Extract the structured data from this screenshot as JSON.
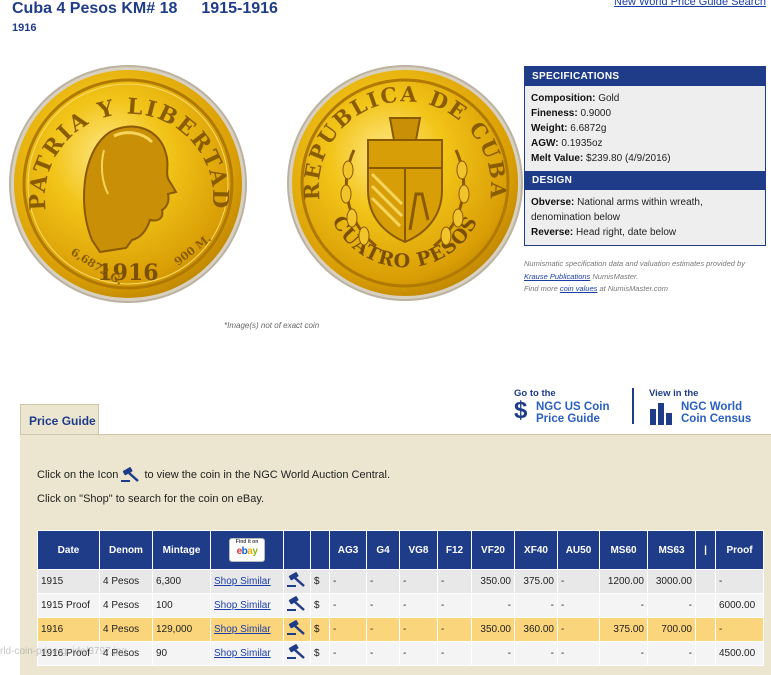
{
  "header": {
    "title": "Cuba 4 Pesos KM# 18",
    "years": "1915-1916",
    "subyear": "1916",
    "top_link": "New World Price Guide Search"
  },
  "coin_obverse": {
    "legend": "PATRIA Y LIBERTAD",
    "date": "1916",
    "fineness": "900 M.",
    "weight": "6,6872 G."
  },
  "coin_reverse": {
    "legend": "REPUBLICA DE CUBA",
    "denomination": "CUATRO PESOS"
  },
  "image_note": "*Image(s) not of exact coin",
  "specifications": {
    "heading": "SPECIFICATIONS",
    "items": [
      {
        "label": "Composition:",
        "value": "Gold"
      },
      {
        "label": "Fineness:",
        "value": "0.9000"
      },
      {
        "label": "Weight:",
        "value": "6.6872g"
      },
      {
        "label": "AGW:",
        "value": "0.1935oz"
      },
      {
        "label": "Melt Value:",
        "value": "$239.80 (4/9/2016)"
      }
    ]
  },
  "design": {
    "heading": "DESIGN",
    "obverse_label": "Obverse:",
    "obverse_value": "National arms within wreath, denomination below",
    "reverse_label": "Reverse:",
    "reverse_value": "Head right, date below"
  },
  "spec_note": {
    "line1": "Numismatic specification data and valuation estimates provided by",
    "link1": "Krause Publications",
    "line2_rest": " NumisMaster.",
    "line3_prefix": "Find more ",
    "link2": "coin values",
    "line3_suffix": " at NumisMaster.com"
  },
  "links": {
    "us_goto": "Go to the",
    "us_line1": "NGC US Coin",
    "us_line2": "Price Guide",
    "world_goto": "View in the",
    "world_line1": "NGC World",
    "world_line2": "Coin Census"
  },
  "tab_label": "Price Guide",
  "instructions": {
    "line1_prefix": "Click on the Icon",
    "line1_suffix": "to view the coin in the NGC World Auction Central.",
    "line2": "Click on \"Shop\" to search for the coin on eBay."
  },
  "ebay_badge": {
    "top": "Find it on",
    "logo": "ebay"
  },
  "table": {
    "headers": [
      "Date",
      "Denom",
      "Mintage",
      "",
      "",
      "",
      "AG3",
      "G4",
      "VG8",
      "F12",
      "VF20",
      "XF40",
      "AU50",
      "MS60",
      "MS63",
      "|",
      "Proof"
    ],
    "rows": [
      {
        "date": "1915",
        "denom": "4 Pesos",
        "mintage": "6,300",
        "shop": "Shop Similar",
        "dollar": "$",
        "ag3": "-",
        "g4": "-",
        "vg8": "-",
        "f12": "-",
        "vf20": "350.00",
        "xf40": "375.00",
        "au50": "-",
        "ms60": "1200.00",
        "ms63": "3000.00",
        "bar": "",
        "proof": "-",
        "highlight": false
      },
      {
        "date": "1915 Proof",
        "denom": "4 Pesos",
        "mintage": "100",
        "shop": "Shop Similar",
        "dollar": "$",
        "ag3": "-",
        "g4": "-",
        "vg8": "-",
        "f12": "-",
        "vf20": "-",
        "xf40": "-",
        "au50": "-",
        "ms60": "-",
        "ms63": "-",
        "bar": "",
        "proof": "6000.00",
        "highlight": false
      },
      {
        "date": "1916",
        "denom": "4 Pesos",
        "mintage": "129,000",
        "shop": "Shop Similar",
        "dollar": "$",
        "ag3": "-",
        "g4": "-",
        "vg8": "-",
        "f12": "-",
        "vf20": "350.00",
        "xf40": "360.00",
        "au50": "-",
        "ms60": "375.00",
        "ms63": "700.00",
        "bar": "",
        "proof": "-",
        "highlight": true
      },
      {
        "date": "1916 Proof",
        "denom": "4 Pesos",
        "mintage": "90",
        "shop": "Shop Similar",
        "dollar": "$",
        "ag3": "-",
        "g4": "-",
        "vg8": "-",
        "f12": "-",
        "vf20": "-",
        "xf40": "-",
        "au50": "-",
        "ms60": "-",
        "ms63": "-",
        "bar": "",
        "proof": "4500.00",
        "highlight": false
      }
    ]
  },
  "watermark": "rld-coin-price-guide/3797.jpg",
  "colors": {
    "navy": "#1f3c88",
    "link": "#1a3ea8",
    "panel": "#ece6d0",
    "highlight_row": "#fbd57b",
    "gold": "#e6b511"
  }
}
